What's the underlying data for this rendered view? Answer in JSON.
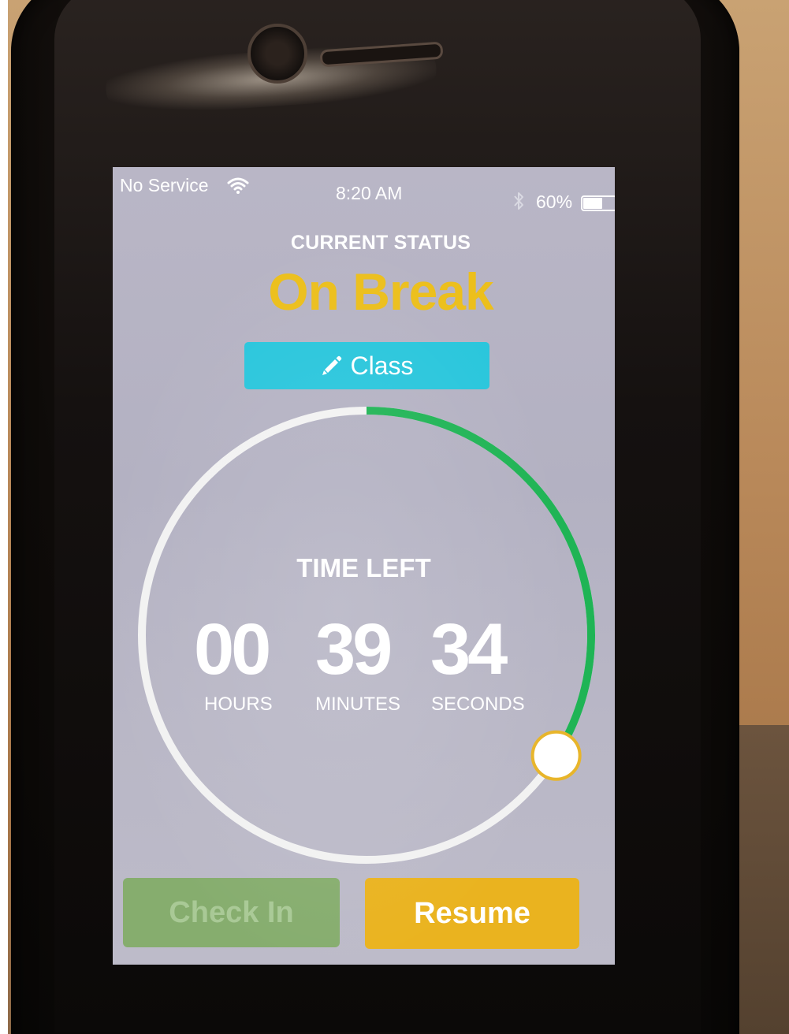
{
  "status_bar": {
    "carrier": "No Service",
    "time": "8:20 AM",
    "battery_percent": "60%",
    "battery_level": 0.6,
    "icons": [
      "wifi-icon",
      "bluetooth-icon",
      "battery-icon"
    ]
  },
  "status": {
    "caption": "CURRENT STATUS",
    "value": "On Break",
    "value_color": "#ecbf1c"
  },
  "edit_button": {
    "icon": "pencil-icon",
    "label": "Class",
    "color": "#29c6dc"
  },
  "timer": {
    "label": "TIME LEFT",
    "hours": "00",
    "minutes": "39",
    "seconds": "34",
    "hours_label": "HOURS",
    "minutes_label": "MINUTES",
    "seconds_label": "SECONDS",
    "progress_fraction": 0.34,
    "progress_color": "#1fb455",
    "track_color": "#f2f2f2"
  },
  "actions": {
    "check_in_label": "Check In",
    "check_in_color": "#86ad6e",
    "resume_label": "Resume",
    "resume_color": "#eab31f"
  }
}
